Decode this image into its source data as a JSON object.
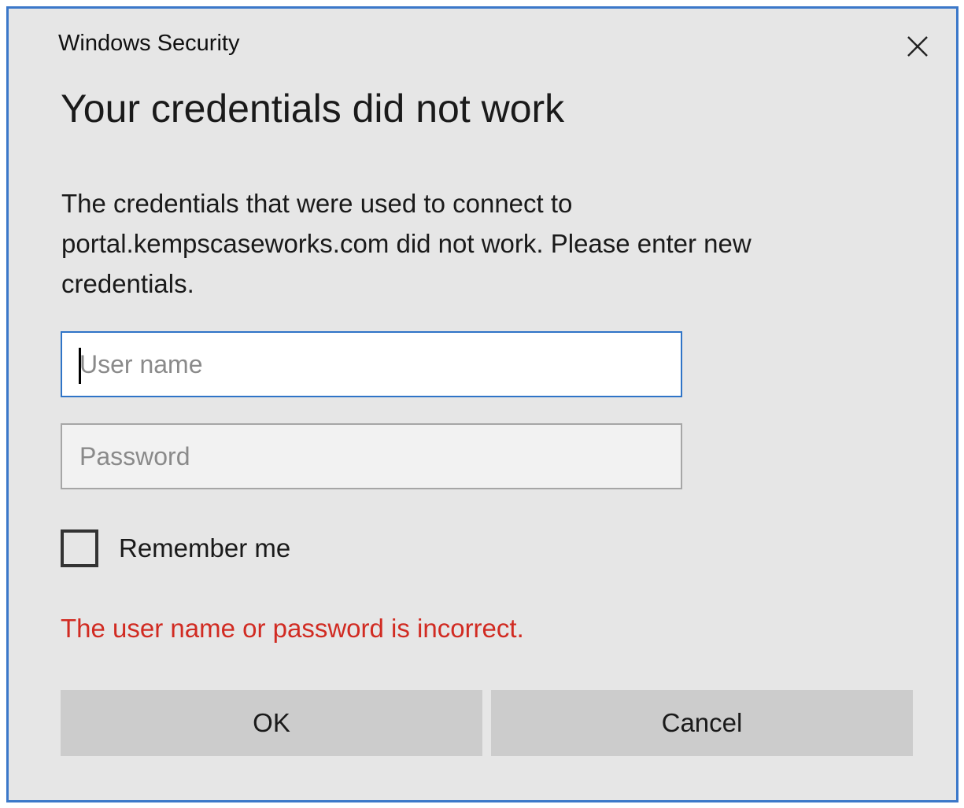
{
  "window": {
    "title": "Windows Security",
    "close_icon": "close-icon"
  },
  "dialog": {
    "heading": "Your credentials did not work",
    "message": "The credentials that were used to connect to portal.kempscaseworks.com did not work. Please enter new credentials."
  },
  "form": {
    "username": {
      "value": "",
      "placeholder": "User name"
    },
    "password": {
      "value": "",
      "placeholder": "Password"
    },
    "remember_me": {
      "label": "Remember me",
      "checked": false
    },
    "error": "The user name or password is incorrect."
  },
  "buttons": {
    "ok": "OK",
    "cancel": "Cancel"
  },
  "colors": {
    "accent": "#2f74c7",
    "window_border": "#3b78c9",
    "error": "#d12b22",
    "background": "#e6e6e6",
    "button": "#cccccc"
  }
}
